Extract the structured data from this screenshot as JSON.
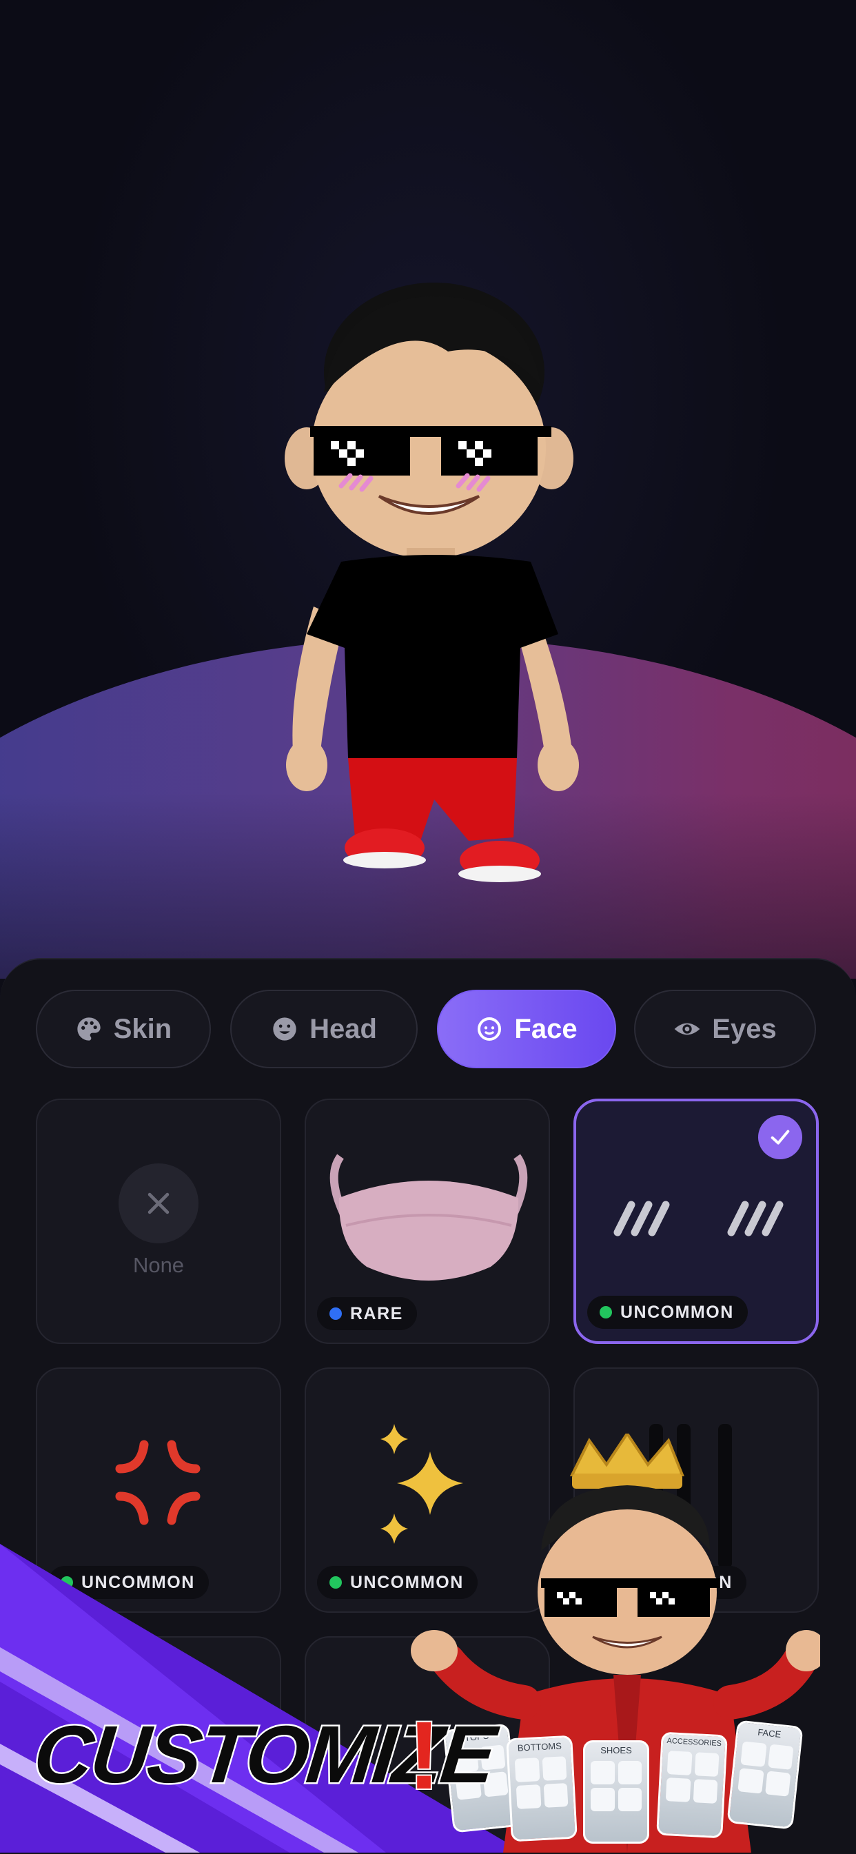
{
  "tabs": [
    {
      "label": "Skin",
      "icon": "palette-icon",
      "active": false
    },
    {
      "label": "Head",
      "icon": "face-smile-icon",
      "active": false
    },
    {
      "label": "Face",
      "icon": "face-outline-icon",
      "active": true
    },
    {
      "label": "Eyes",
      "icon": "eye-icon",
      "active": false
    }
  ],
  "items": [
    {
      "name": "none",
      "label": "None",
      "badge": null,
      "selected": false
    },
    {
      "name": "face-mask",
      "badge": "RARE",
      "badge_color": "#2f6ff5",
      "selected": false
    },
    {
      "name": "blush-marks",
      "badge": "UNCOMMON",
      "badge_color": "#22c55e",
      "selected": true
    },
    {
      "name": "anger-symbol",
      "badge": "UNCOMMON",
      "badge_color": "#22c55e",
      "selected": false
    },
    {
      "name": "sparkles",
      "badge": "UNCOMMON",
      "badge_color": "#22c55e",
      "selected": false
    },
    {
      "name": "tear-lines",
      "badge": "UNCOMMON",
      "badge_color": "#22c55e",
      "selected": false
    }
  ],
  "promo": {
    "headline": "CUSTOMIZE",
    "exclamation": "!",
    "cards": [
      "TOPS",
      "BOTTOMS",
      "SHOES",
      "ACCESSORIES",
      "FACE"
    ]
  },
  "colors": {
    "accent": "#8b66ee",
    "rare": "#2f6ff5",
    "uncommon": "#22c55e"
  }
}
